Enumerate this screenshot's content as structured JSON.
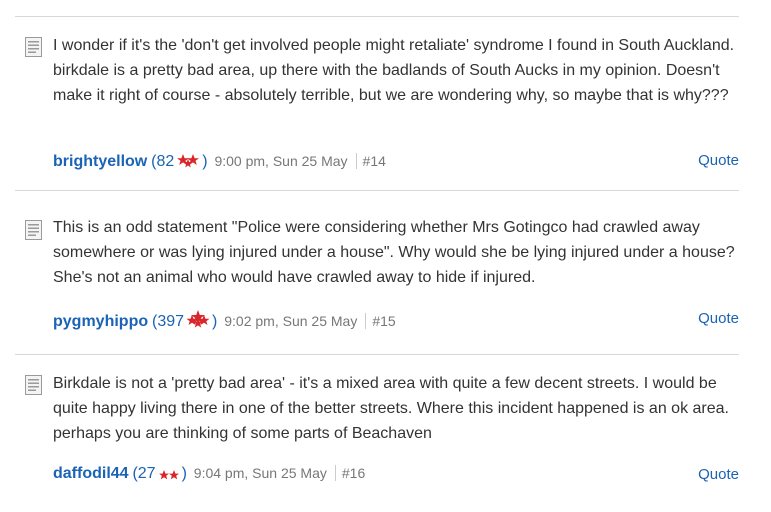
{
  "posts": [
    {
      "text": "I wonder if it's the 'don't get involved people might retaliate' syndrome I found in South Auckland. birkdale is a pretty bad area, up there with the badlands of South Aucks in my opinion. Doesn't make it right of course - absolutely terrible, but we are wondering why, so maybe that is why???",
      "user": "brightyellow",
      "rep_open": "(82",
      "rep_close": ")",
      "time": "9:00 pm, Sun 25 May",
      "number": "#14",
      "quote_label": "Quote"
    },
    {
      "text": "This is an odd statement \"Police were considering whether Mrs Gotingco had crawled away somewhere or was lying injured under a house\". Why would she be lying injured under a house? She's not an animal who would have crawled away to hide if injured.",
      "user": "pygmyhippo",
      "rep_open": "(397",
      "rep_close": ")",
      "time": "9:02 pm, Sun 25 May",
      "number": "#15",
      "quote_label": "Quote"
    },
    {
      "text": "Birkdale is not a 'pretty bad area' - it's a mixed area with quite a few decent streets. I would be quite happy living there in one of the better streets. Where this incident happened is an ok area. perhaps you are thinking of some parts of Beachaven",
      "user": "daffodil44",
      "rep_open": "(27",
      "rep_close": ")",
      "time": "9:04 pm, Sun 25 May",
      "number": "#16",
      "quote_label": "Quote"
    }
  ],
  "colors": {
    "link": "#1a63b5",
    "star": "#d9262b",
    "meta": "#777777",
    "text": "#333333",
    "divider": "#d8d8d8"
  },
  "icons": {
    "post": "document-icon",
    "reputation": "reputation-stars-icon"
  }
}
